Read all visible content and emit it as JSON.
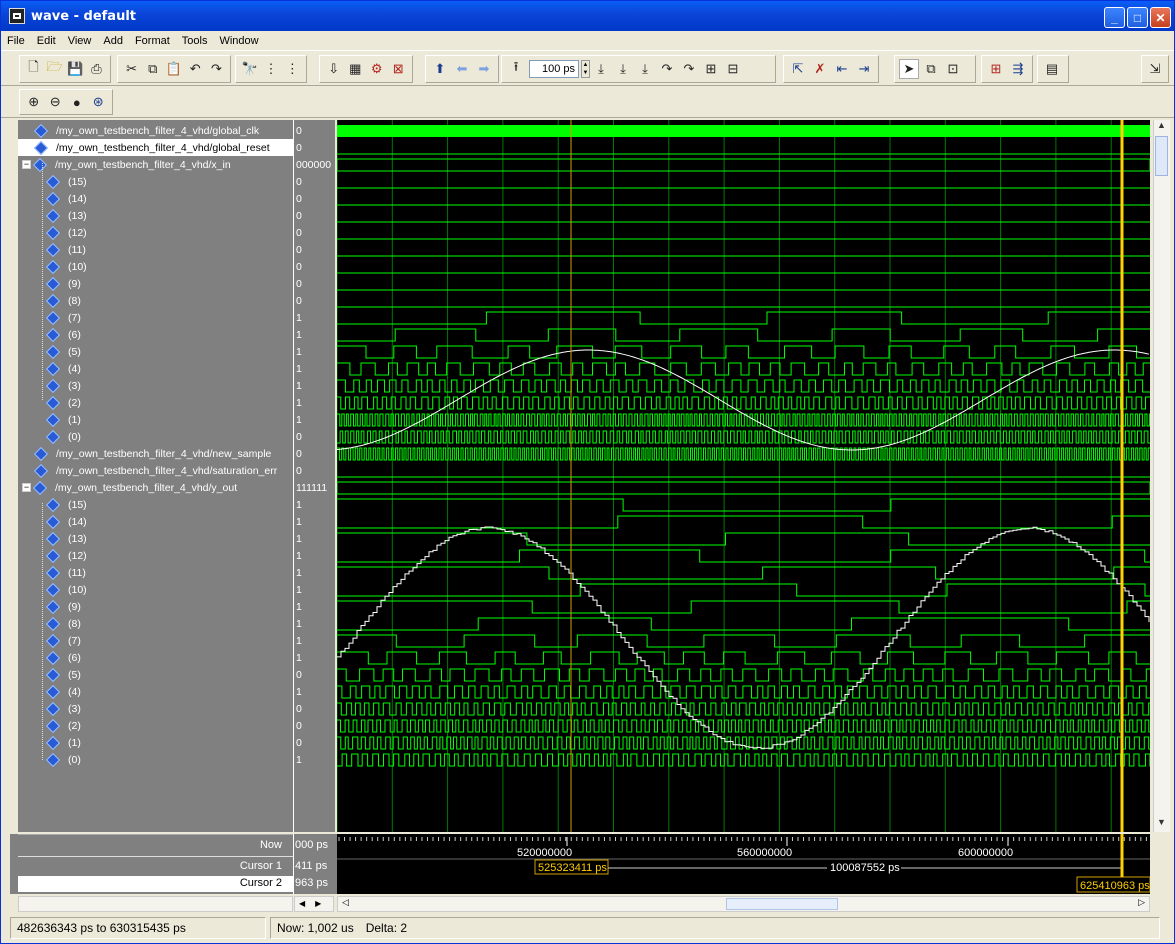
{
  "window": {
    "title": "wave - default"
  },
  "menu": [
    "File",
    "Edit",
    "View",
    "Add",
    "Format",
    "Tools",
    "Window"
  ],
  "toolbar": {
    "zoom_value": "100 ps"
  },
  "signals": [
    {
      "name": "/my_own_testbench_filter_4_vhd/global_clk",
      "value": "0",
      "level": 0,
      "type": "signal"
    },
    {
      "name": "/my_own_testbench_filter_4_vhd/global_reset",
      "value": "0",
      "level": 0,
      "type": "signal",
      "selected": true
    },
    {
      "name": "/my_own_testbench_filter_4_vhd/x_in",
      "value": "000000",
      "level": 0,
      "type": "bus"
    },
    {
      "name": "(15)",
      "value": "0",
      "level": 1
    },
    {
      "name": "(14)",
      "value": "0",
      "level": 1
    },
    {
      "name": "(13)",
      "value": "0",
      "level": 1
    },
    {
      "name": "(12)",
      "value": "0",
      "level": 1
    },
    {
      "name": "(11)",
      "value": "0",
      "level": 1
    },
    {
      "name": "(10)",
      "value": "0",
      "level": 1
    },
    {
      "name": "(9)",
      "value": "0",
      "level": 1
    },
    {
      "name": "(8)",
      "value": "0",
      "level": 1
    },
    {
      "name": "(7)",
      "value": "1",
      "level": 1
    },
    {
      "name": "(6)",
      "value": "1",
      "level": 1
    },
    {
      "name": "(5)",
      "value": "1",
      "level": 1
    },
    {
      "name": "(4)",
      "value": "1",
      "level": 1
    },
    {
      "name": "(3)",
      "value": "1",
      "level": 1
    },
    {
      "name": "(2)",
      "value": "1",
      "level": 1
    },
    {
      "name": "(1)",
      "value": "1",
      "level": 1
    },
    {
      "name": "(0)",
      "value": "0",
      "level": 1
    },
    {
      "name": "/my_own_testbench_filter_4_vhd/new_sample",
      "value": "0",
      "level": 0,
      "type": "signal"
    },
    {
      "name": "/my_own_testbench_filter_4_vhd/saturation_err",
      "value": "0",
      "level": 0,
      "type": "signal"
    },
    {
      "name": "/my_own_testbench_filter_4_vhd/y_out",
      "value": "111111",
      "level": 0,
      "type": "bus"
    },
    {
      "name": "(15)",
      "value": "1",
      "level": 1
    },
    {
      "name": "(14)",
      "value": "1",
      "level": 1
    },
    {
      "name": "(13)",
      "value": "1",
      "level": 1
    },
    {
      "name": "(12)",
      "value": "1",
      "level": 1
    },
    {
      "name": "(11)",
      "value": "1",
      "level": 1
    },
    {
      "name": "(10)",
      "value": "1",
      "level": 1
    },
    {
      "name": "(9)",
      "value": "1",
      "level": 1
    },
    {
      "name": "(8)",
      "value": "1",
      "level": 1
    },
    {
      "name": "(7)",
      "value": "1",
      "level": 1
    },
    {
      "name": "(6)",
      "value": "1",
      "level": 1
    },
    {
      "name": "(5)",
      "value": "0",
      "level": 1
    },
    {
      "name": "(4)",
      "value": "1",
      "level": 1
    },
    {
      "name": "(3)",
      "value": "0",
      "level": 1
    },
    {
      "name": "(2)",
      "value": "0",
      "level": 1
    },
    {
      "name": "(1)",
      "value": "0",
      "level": 1
    },
    {
      "name": "(0)",
      "value": "1",
      "level": 1
    }
  ],
  "bottom": {
    "now_label": "Now",
    "now_value": "000 ps",
    "cursor1_label": "Cursor 1",
    "cursor1_value": "411 ps",
    "cursor2_label": "Cursor 2",
    "cursor2_value": "963 ps",
    "ticks": [
      "520000000",
      "560000000",
      "600000000"
    ],
    "cursor1_time": "525323411 ps",
    "cursor2_time": "625410963 ps",
    "delta_time": "100087552 ps"
  },
  "status": {
    "range": "482636343 ps to 630315435 ps",
    "now": "Now: 1,002 us",
    "delta": "Delta: 2"
  },
  "colors": {
    "wave": "#00ff00",
    "analog": "#ffffff",
    "cursor": "#ffd100",
    "grid": "#007a00",
    "background": "#000000"
  }
}
